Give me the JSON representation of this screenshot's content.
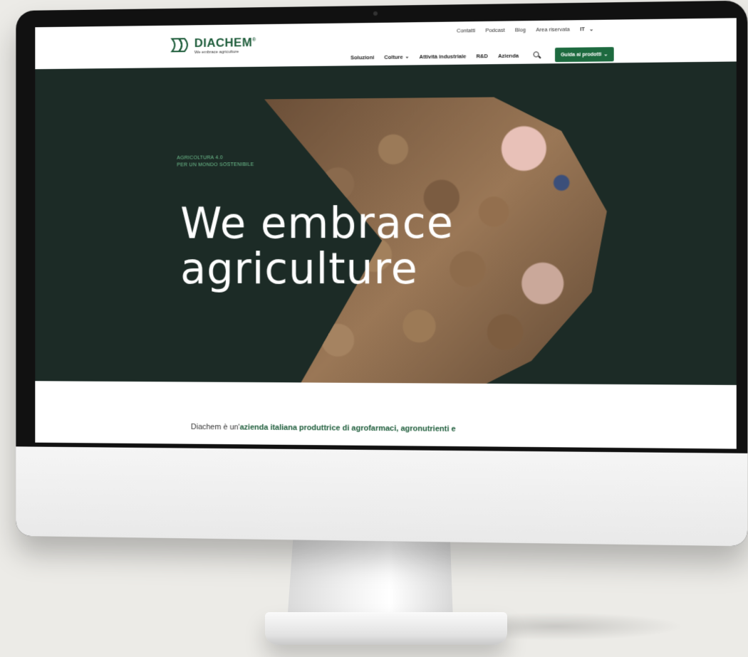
{
  "brand": {
    "name": "DIACHEM",
    "registered_mark": "®",
    "tagline": "We embrace agriculture",
    "accent_color": "#1d6a3f",
    "hero_bg_color": "#1c2b26"
  },
  "top_links": {
    "contact": "Contatti",
    "podcast": "Podcast",
    "blog": "Blog",
    "reserved_area": "Area riservata",
    "language": "IT"
  },
  "main_nav": {
    "items": [
      "Soluzioni",
      "Colture",
      "Attività industriale",
      "R&D",
      "Azienda"
    ],
    "cta": "Guida ai prodotti"
  },
  "hero": {
    "eyebrow_line1": "AGRICOLTURA 4.0",
    "eyebrow_line2": "PER UN MONDO SOSTENIBILE",
    "title_line1": "We embrace",
    "title_line2": "agriculture"
  },
  "intro": {
    "prefix": "Diachem è un'",
    "bold": "azienda italiana produttrice di agrofarmaci, agronutrienti e"
  }
}
